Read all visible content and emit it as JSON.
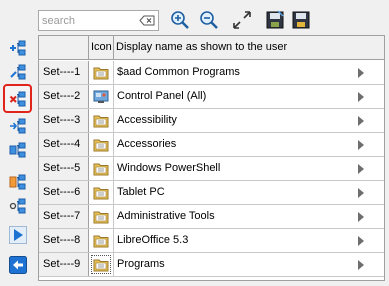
{
  "search": {
    "placeholder": "search",
    "value": ""
  },
  "top_toolbar": {
    "clear_icon": "clear-search-icon",
    "buttons": [
      {
        "name": "zoom-in-icon"
      },
      {
        "name": "zoom-out-icon"
      },
      {
        "name": "expand-icon"
      },
      {
        "name": "save-as-icon"
      },
      {
        "name": "save-icon"
      }
    ]
  },
  "left_toolbar": {
    "buttons": [
      {
        "name": "add-set-icon"
      },
      {
        "name": "edit-set-icon"
      },
      {
        "name": "delete-set-icon",
        "selected": true
      },
      {
        "name": "move-set-icon"
      },
      {
        "name": "copy-set-icon"
      },
      {
        "name": "folder-set-icon"
      },
      {
        "name": "link-set-icon"
      },
      {
        "name": "run-icon"
      },
      {
        "name": "back-icon"
      }
    ]
  },
  "grid": {
    "columns": [
      "",
      "Icon",
      "Display name as shown to the user"
    ],
    "rows": [
      {
        "set": "Set----1",
        "icon": "folder-icon",
        "name": "$aad Common Programs"
      },
      {
        "set": "Set----2",
        "icon": "control-panel-icon",
        "name": "Control Panel (All)"
      },
      {
        "set": "Set----3",
        "icon": "folder-icon",
        "name": "Accessibility"
      },
      {
        "set": "Set----4",
        "icon": "folder-icon",
        "name": "Accessories"
      },
      {
        "set": "Set----5",
        "icon": "folder-icon",
        "name": "Windows PowerShell"
      },
      {
        "set": "Set----6",
        "icon": "folder-icon",
        "name": "Tablet PC"
      },
      {
        "set": "Set----7",
        "icon": "folder-icon",
        "name": "Administrative Tools"
      },
      {
        "set": "Set----8",
        "icon": "folder-icon",
        "name": "LibreOffice 5.3"
      },
      {
        "set": "Set----9",
        "icon": "folder-icon",
        "name": "Programs"
      }
    ]
  },
  "colors": {
    "accent_blue": "#1e73d2",
    "selection_border": "#e0231b",
    "folder_yellow": "#e8c25a"
  }
}
